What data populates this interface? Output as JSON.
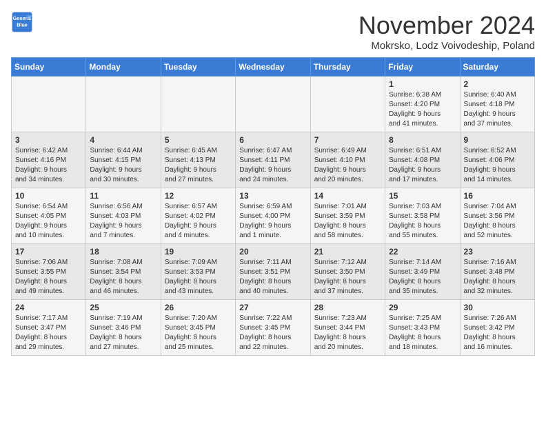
{
  "logo": {
    "line1": "General",
    "line2": "Blue"
  },
  "title": "November 2024",
  "subtitle": "Mokrsko, Lodz Voivodeship, Poland",
  "weekdays": [
    "Sunday",
    "Monday",
    "Tuesday",
    "Wednesday",
    "Thursday",
    "Friday",
    "Saturday"
  ],
  "weeks": [
    [
      {
        "day": "",
        "info": ""
      },
      {
        "day": "",
        "info": ""
      },
      {
        "day": "",
        "info": ""
      },
      {
        "day": "",
        "info": ""
      },
      {
        "day": "",
        "info": ""
      },
      {
        "day": "1",
        "info": "Sunrise: 6:38 AM\nSunset: 4:20 PM\nDaylight: 9 hours\nand 41 minutes."
      },
      {
        "day": "2",
        "info": "Sunrise: 6:40 AM\nSunset: 4:18 PM\nDaylight: 9 hours\nand 37 minutes."
      }
    ],
    [
      {
        "day": "3",
        "info": "Sunrise: 6:42 AM\nSunset: 4:16 PM\nDaylight: 9 hours\nand 34 minutes."
      },
      {
        "day": "4",
        "info": "Sunrise: 6:44 AM\nSunset: 4:15 PM\nDaylight: 9 hours\nand 30 minutes."
      },
      {
        "day": "5",
        "info": "Sunrise: 6:45 AM\nSunset: 4:13 PM\nDaylight: 9 hours\nand 27 minutes."
      },
      {
        "day": "6",
        "info": "Sunrise: 6:47 AM\nSunset: 4:11 PM\nDaylight: 9 hours\nand 24 minutes."
      },
      {
        "day": "7",
        "info": "Sunrise: 6:49 AM\nSunset: 4:10 PM\nDaylight: 9 hours\nand 20 minutes."
      },
      {
        "day": "8",
        "info": "Sunrise: 6:51 AM\nSunset: 4:08 PM\nDaylight: 9 hours\nand 17 minutes."
      },
      {
        "day": "9",
        "info": "Sunrise: 6:52 AM\nSunset: 4:06 PM\nDaylight: 9 hours\nand 14 minutes."
      }
    ],
    [
      {
        "day": "10",
        "info": "Sunrise: 6:54 AM\nSunset: 4:05 PM\nDaylight: 9 hours\nand 10 minutes."
      },
      {
        "day": "11",
        "info": "Sunrise: 6:56 AM\nSunset: 4:03 PM\nDaylight: 9 hours\nand 7 minutes."
      },
      {
        "day": "12",
        "info": "Sunrise: 6:57 AM\nSunset: 4:02 PM\nDaylight: 9 hours\nand 4 minutes."
      },
      {
        "day": "13",
        "info": "Sunrise: 6:59 AM\nSunset: 4:00 PM\nDaylight: 9 hours\nand 1 minute."
      },
      {
        "day": "14",
        "info": "Sunrise: 7:01 AM\nSunset: 3:59 PM\nDaylight: 8 hours\nand 58 minutes."
      },
      {
        "day": "15",
        "info": "Sunrise: 7:03 AM\nSunset: 3:58 PM\nDaylight: 8 hours\nand 55 minutes."
      },
      {
        "day": "16",
        "info": "Sunrise: 7:04 AM\nSunset: 3:56 PM\nDaylight: 8 hours\nand 52 minutes."
      }
    ],
    [
      {
        "day": "17",
        "info": "Sunrise: 7:06 AM\nSunset: 3:55 PM\nDaylight: 8 hours\nand 49 minutes."
      },
      {
        "day": "18",
        "info": "Sunrise: 7:08 AM\nSunset: 3:54 PM\nDaylight: 8 hours\nand 46 minutes."
      },
      {
        "day": "19",
        "info": "Sunrise: 7:09 AM\nSunset: 3:53 PM\nDaylight: 8 hours\nand 43 minutes."
      },
      {
        "day": "20",
        "info": "Sunrise: 7:11 AM\nSunset: 3:51 PM\nDaylight: 8 hours\nand 40 minutes."
      },
      {
        "day": "21",
        "info": "Sunrise: 7:12 AM\nSunset: 3:50 PM\nDaylight: 8 hours\nand 37 minutes."
      },
      {
        "day": "22",
        "info": "Sunrise: 7:14 AM\nSunset: 3:49 PM\nDaylight: 8 hours\nand 35 minutes."
      },
      {
        "day": "23",
        "info": "Sunrise: 7:16 AM\nSunset: 3:48 PM\nDaylight: 8 hours\nand 32 minutes."
      }
    ],
    [
      {
        "day": "24",
        "info": "Sunrise: 7:17 AM\nSunset: 3:47 PM\nDaylight: 8 hours\nand 29 minutes."
      },
      {
        "day": "25",
        "info": "Sunrise: 7:19 AM\nSunset: 3:46 PM\nDaylight: 8 hours\nand 27 minutes."
      },
      {
        "day": "26",
        "info": "Sunrise: 7:20 AM\nSunset: 3:45 PM\nDaylight: 8 hours\nand 25 minutes."
      },
      {
        "day": "27",
        "info": "Sunrise: 7:22 AM\nSunset: 3:45 PM\nDaylight: 8 hours\nand 22 minutes."
      },
      {
        "day": "28",
        "info": "Sunrise: 7:23 AM\nSunset: 3:44 PM\nDaylight: 8 hours\nand 20 minutes."
      },
      {
        "day": "29",
        "info": "Sunrise: 7:25 AM\nSunset: 3:43 PM\nDaylight: 8 hours\nand 18 minutes."
      },
      {
        "day": "30",
        "info": "Sunrise: 7:26 AM\nSunset: 3:42 PM\nDaylight: 8 hours\nand 16 minutes."
      }
    ]
  ]
}
